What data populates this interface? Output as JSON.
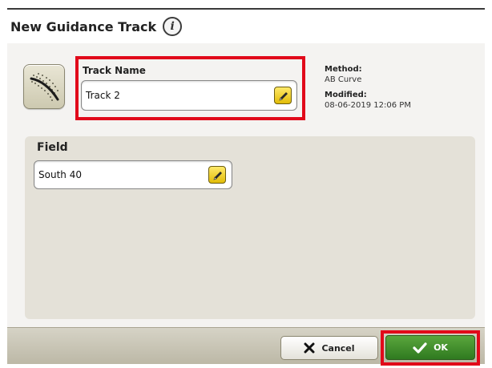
{
  "dialog": {
    "title": "New Guidance Track",
    "info_icon": "info-icon"
  },
  "track_type": {
    "icon": "ab-curve-track-icon"
  },
  "track_name": {
    "label": "Track Name",
    "value": "Track 2",
    "edit_icon": "pencil-icon"
  },
  "meta": {
    "method_label": "Method:",
    "method_value": "AB Curve",
    "modified_label": "Modified:",
    "modified_value": "08-06-2019 12:06 PM"
  },
  "field": {
    "title": "Field",
    "value": "South 40",
    "edit_icon": "pencil-icon"
  },
  "footer": {
    "cancel_label": "Cancel",
    "cancel_icon": "close-icon",
    "ok_label": "OK",
    "ok_icon": "checkmark-icon"
  },
  "colors": {
    "highlight": "#e1091a",
    "ok_green": "#3a8a28",
    "edit_yellow": "#f2cf1d",
    "panel": "#e4e1d8"
  }
}
